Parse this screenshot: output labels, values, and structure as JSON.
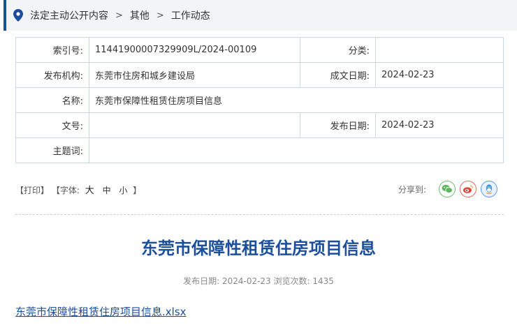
{
  "breadcrumb": {
    "items": [
      "法定主动公开内容",
      "其他",
      "工作动态"
    ],
    "separator": ">"
  },
  "meta": {
    "index_label": "索引号:",
    "index_value": "11441900007329909L/2024-00109",
    "category_label": "分类:",
    "category_value": "",
    "issuer_label": "发布机构:",
    "issuer_value": "东莞市住房和城乡建设局",
    "created_label": "成文日期:",
    "created_value": "2024-02-23",
    "name_label": "名称:",
    "name_value": "东莞市保障性租赁住房项目信息",
    "docno_label": "文号:",
    "docno_value": "",
    "published_label": "发布日期:",
    "published_value": "2024-02-23",
    "subject_label": "主题词:",
    "subject_value": ""
  },
  "tools": {
    "print": "【打印】",
    "font_prefix": "【字体:",
    "font_large": "大",
    "font_medium": "中",
    "font_small": "小",
    "font_suffix": "】"
  },
  "share": {
    "label": "分享到:",
    "icons": [
      "wechat-icon",
      "weibo-icon",
      "qq-icon"
    ]
  },
  "article": {
    "title": "东莞市保障性租赁住房项目信息",
    "info": "发布日期: 2024-02-23 浏览次数: 1435",
    "attachment": "东莞市保障性租赁住房项目信息.xlsx"
  },
  "colors": {
    "accent": "#1b4f9c",
    "border": "#c8d8e8",
    "breadcrumb_bg": "#f2f4f7"
  }
}
